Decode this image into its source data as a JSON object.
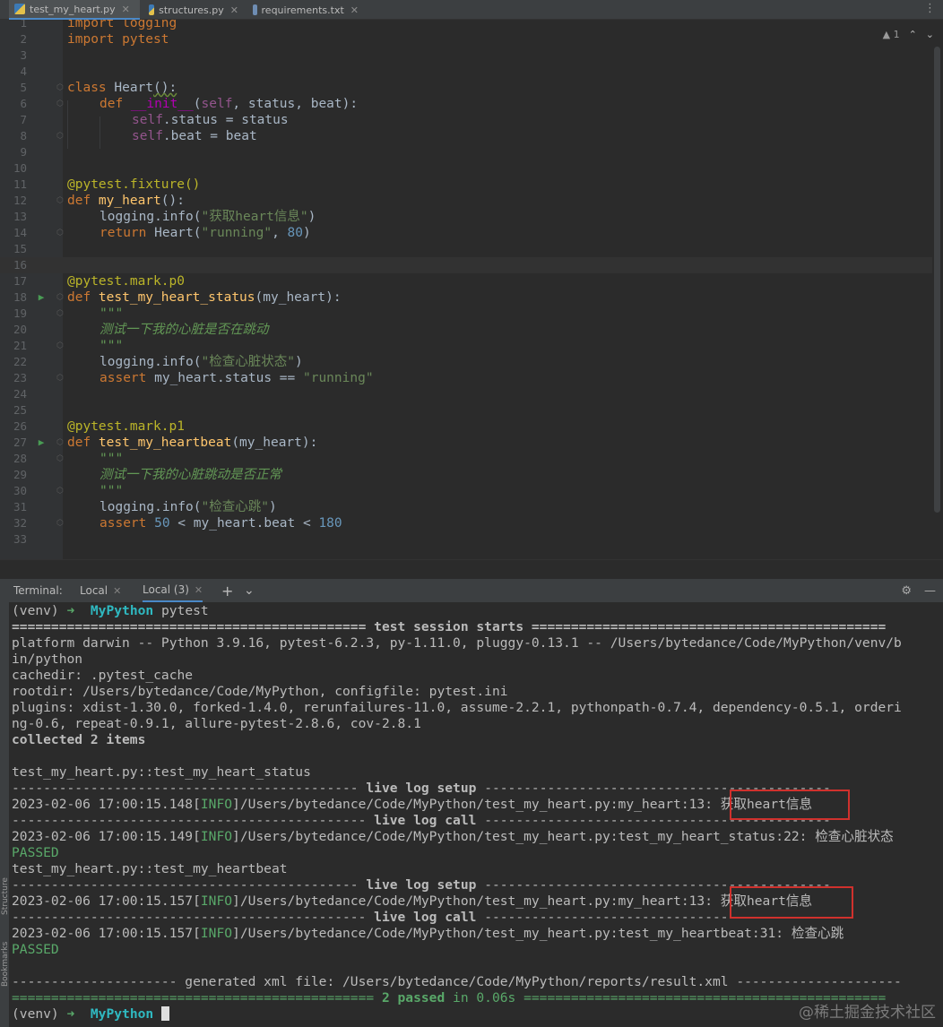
{
  "tabs": [
    {
      "label": "test_my_heart.py",
      "icon": "python-file-icon",
      "active": true
    },
    {
      "label": "structures.py",
      "icon": "python-file-icon",
      "active": false
    },
    {
      "label": "requirements.txt",
      "icon": "text-file-icon",
      "active": false
    }
  ],
  "editor": {
    "inspection_count": "1",
    "line_numbers": [
      "1",
      "2",
      "3",
      "4",
      "5",
      "6",
      "7",
      "8",
      "9",
      "10",
      "11",
      "12",
      "13",
      "14",
      "15",
      "16",
      "17",
      "18",
      "19",
      "20",
      "21",
      "22",
      "23",
      "24",
      "25",
      "26",
      "27",
      "28",
      "29",
      "30",
      "31",
      "32",
      "33"
    ],
    "lines": {
      "l1": "import logging",
      "l2": "import pytest",
      "l5a": "class ",
      "l5b": "Heart",
      "l5c": "():",
      "l6a": "def ",
      "l6b": "__init__",
      "l6c": "(",
      "l6d": "self",
      "l6e": ", status, beat):",
      "l7a": "self",
      "l7b": ".status = status",
      "l8a": "self",
      "l8b": ".beat = beat",
      "l11": "@pytest.fixture()",
      "l12a": "def ",
      "l12b": "my_heart",
      "l12c": "():",
      "l13a": "logging.info(",
      "l13b": "\"获取heart信息\"",
      "l13c": ")",
      "l14a": "return ",
      "l14b": "Heart(",
      "l14c": "\"running\"",
      "l14d": ", ",
      "l14e": "80",
      "l14f": ")",
      "l17": "@pytest.mark.p0",
      "l18a": "def ",
      "l18b": "test_my_heart_status",
      "l18c": "(my_heart):",
      "l19": "\"\"\"",
      "l20": "测试一下我的心脏是否在跳动",
      "l21": "\"\"\"",
      "l22a": "logging.info(",
      "l22b": "\"检查心脏状态\"",
      "l22c": ")",
      "l23a": "assert ",
      "l23b": "my_heart.status == ",
      "l23c": "\"running\"",
      "l26": "@pytest.mark.p1",
      "l27a": "def ",
      "l27b": "test_my_heartbeat",
      "l27c": "(my_heart):",
      "l28": "\"\"\"",
      "l29": "测试一下我的心脏跳动是否正常",
      "l30": "\"\"\"",
      "l31a": "logging.info(",
      "l31b": "\"检查心跳\"",
      "l31c": ")",
      "l32a": "assert ",
      "l32b": "50",
      "l32c": " < my_heart.beat < ",
      "l32d": "180"
    }
  },
  "terminal": {
    "label": "Terminal:",
    "tabs": [
      {
        "label": "Local",
        "active": false
      },
      {
        "label": "Local (3)",
        "active": true
      }
    ],
    "add": "+",
    "dropdown": "⌄",
    "settings": "⚙",
    "minimize": "—",
    "prompt_venv": "(venv)",
    "prompt_arrow": "➜",
    "prompt_dir": "MyPython",
    "command": "pytest",
    "lines": {
      "session_start_a": "============================================= ",
      "session_start_b": "test session starts",
      "session_start_c": " =============================================",
      "platform1": "platform darwin -- Python 3.9.16, pytest-6.2.3, py-1.11.0, pluggy-0.13.1 -- /Users/bytedance/Code/MyPython/venv/b",
      "platform2": "in/python",
      "cachedir": "cachedir: .pytest_cache",
      "rootdir": "rootdir: /Users/bytedance/Code/MyPython, configfile: pytest.ini",
      "plugins1": "plugins: xdist-1.30.0, forked-1.4.0, rerunfailures-11.0, assume-2.2.1, pythonpath-0.7.4, dependency-0.5.1, orderi",
      "plugins2": "ng-0.6, repeat-0.9.1, allure-pytest-2.8.6, cov-2.8.1",
      "collected": "collected 2 items",
      "test1": "test_my_heart.py::test_my_heart_status",
      "log_setup_a": "-------------------------------------------- ",
      "log_setup_b": "live log setup",
      "log_setup_c": " --------------------------------------------",
      "log_call_a": "--------------------------------------------- ",
      "log_call_b": "live log call",
      "log_call_c": " --------------------------------------------",
      "r1a": "2023-02-06 17:00:15.148[",
      "r1b": "INFO",
      "r1c": "]/Users/bytedance/Code/MyPython/test_my_heart.py:my_heart:13: ",
      "r1d": "获取heart信息",
      "r2a": "2023-02-06 17:00:15.149[",
      "r2b": "INFO",
      "r2c": "]/Users/bytedance/Code/MyPython/test_my_heart.py:test_my_heart_status:22: 检查心脏状态",
      "passed": "PASSED",
      "test2": "test_my_heart.py::test_my_heartbeat",
      "r3a": "2023-02-06 17:00:15.157[",
      "r3b": "INFO",
      "r3c": "]/Users/bytedance/Code/MyPython/test_my_heart.py:my_heart:13: ",
      "r3d": "获取heart信息",
      "r4a": "2023-02-06 17:00:15.157[",
      "r4b": "INFO",
      "r4c": "]/Users/bytedance/Code/MyPython/test_my_heart.py:test_my_heartbeat:31: 检查心跳",
      "xml": "--------------------- generated xml file: /Users/bytedance/Code/MyPython/reports/result.xml ---------------------",
      "sum_a": "============================================== ",
      "sum_b": "2 passed",
      "sum_c": " in 0.06s",
      "sum_d": " =============================================="
    }
  },
  "left_strip_labels": [
    "Structure",
    "Bookmarks"
  ],
  "watermark": "@稀土掘金技术社区",
  "colors": {
    "editor_bg": "#2b2b2b",
    "keyword": "#cc7832",
    "string": "#6a8759",
    "number": "#6897bb",
    "decorator": "#bbb529",
    "function": "#ffc66d",
    "prompt_dir": "#2fb9c1",
    "passed": "#59a869",
    "highlight_box": "#d0312d"
  }
}
